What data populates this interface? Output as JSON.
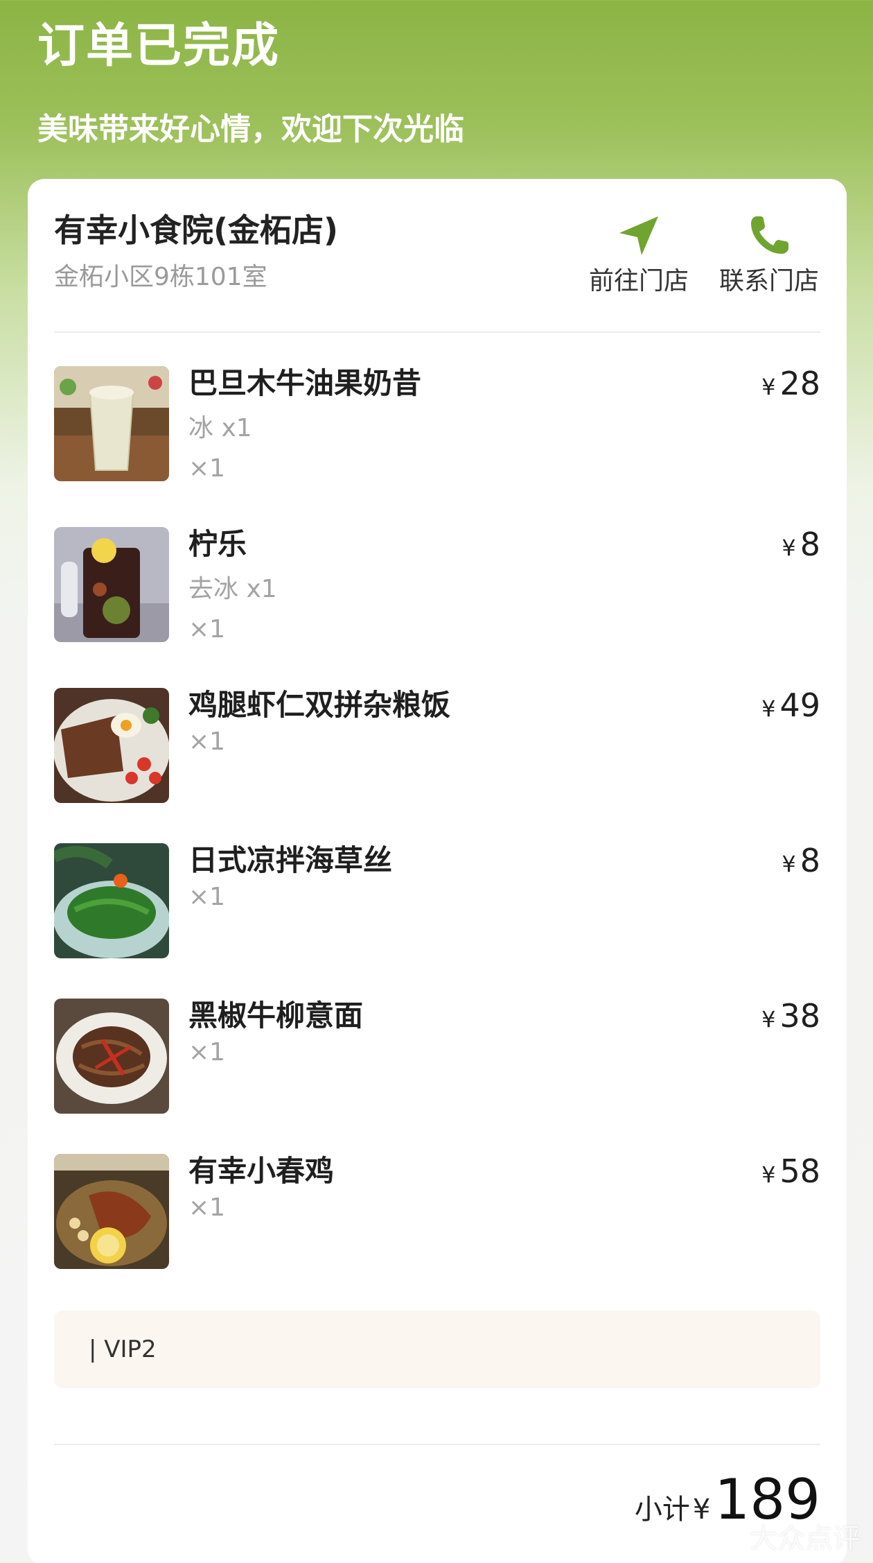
{
  "header": {
    "title": "订单已完成",
    "subtitle": "美味带来好心情，欢迎下次光临"
  },
  "store": {
    "name": "有幸小食院(金柘店)",
    "address": "金柘小区9栋101室",
    "actions": [
      {
        "label": "前往门店",
        "icon": "navigation-arrow-icon"
      },
      {
        "label": "联系门店",
        "icon": "phone-icon"
      }
    ]
  },
  "items": [
    {
      "name": "巴旦木牛油果奶昔",
      "price": "28",
      "spec": "冰 x1",
      "qty": "×1"
    },
    {
      "name": "柠乐",
      "price": "8",
      "spec": "去冰 x1",
      "qty": "×1"
    },
    {
      "name": "鸡腿虾仁双拼杂粮饭",
      "price": "49",
      "qty": "×1"
    },
    {
      "name": "日式凉拌海草丝",
      "price": "8",
      "qty": "×1"
    },
    {
      "name": "黑椒牛柳意面",
      "price": "38",
      "qty": "×1"
    },
    {
      "name": "有幸小春鸡",
      "price": "58",
      "qty": "×1"
    }
  ],
  "currency": "¥",
  "vip": {
    "text": "| VIP2"
  },
  "subtotal": {
    "label": "小计",
    "amount": "189"
  },
  "watermark": "大众点评",
  "colors": {
    "accent": "#6fa52f",
    "header_green": "#8bb444"
  }
}
